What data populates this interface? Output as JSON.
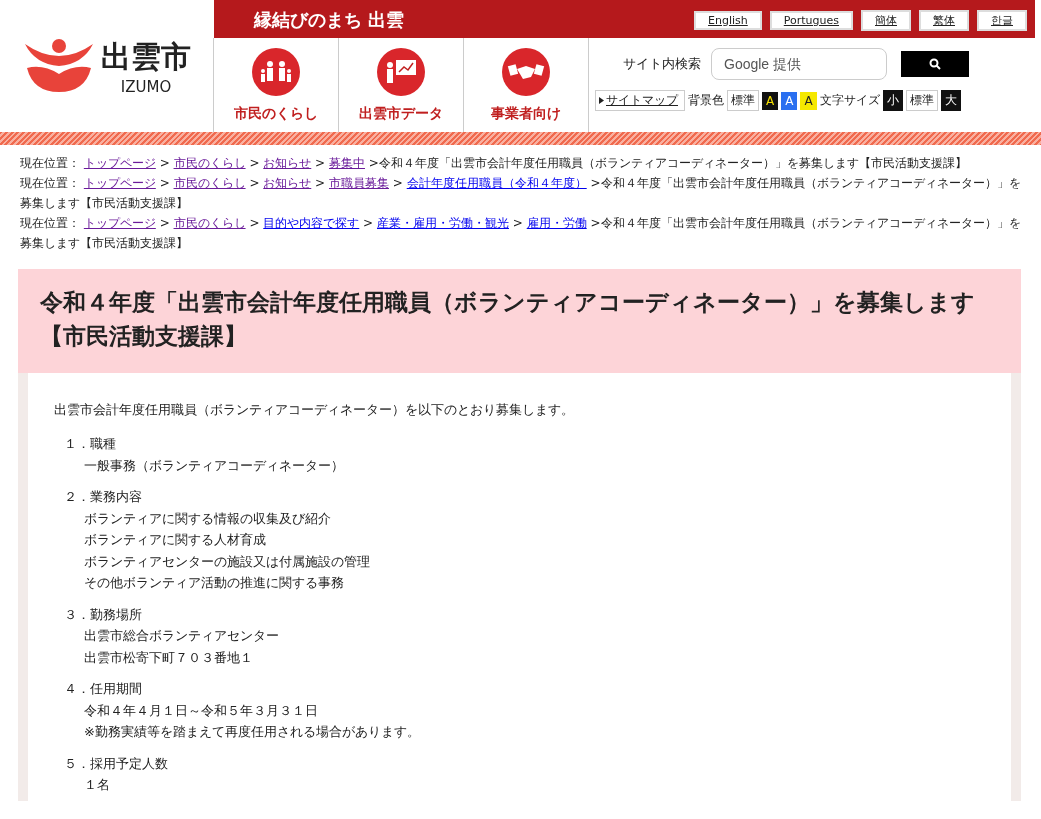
{
  "header": {
    "logo_name": "出雲市",
    "logo_roman": "IZUMO",
    "slogan": "縁結びのまち 出雲",
    "languages": [
      "English",
      "Portugues",
      "簡体",
      "繁体",
      "한글"
    ],
    "nav": [
      {
        "label": "市民のくらし",
        "kind": "family"
      },
      {
        "label": "出雲市データ",
        "kind": "chart"
      },
      {
        "label": "事業者向け",
        "kind": "handshake"
      }
    ],
    "search": {
      "label": "サイト内検索",
      "placeholder": "Google 提供"
    },
    "sitemap": "サイトマップ",
    "bg_label": "背景色",
    "bg_options": [
      {
        "label": "標準",
        "kind": "plain"
      },
      {
        "label": "A",
        "kind": "black"
      },
      {
        "label": "A",
        "kind": "blue"
      },
      {
        "label": "A",
        "kind": "yellow"
      }
    ],
    "size_label": "文字サイズ",
    "size_options": [
      {
        "label": "小",
        "kind": "dark"
      },
      {
        "label": "標準",
        "kind": "plain"
      },
      {
        "label": "大",
        "kind": "dark"
      }
    ]
  },
  "breadcrumbs": {
    "separator": ">",
    "trails": [
      {
        "label": "現在位置：",
        "links": [
          {
            "text": "トップページ",
            "visited": true
          },
          {
            "text": "市民のくらし",
            "visited": true
          },
          {
            "text": "お知らせ",
            "visited": true
          },
          {
            "text": "募集中",
            "visited": true
          }
        ],
        "current": "令和４年度「出雲市会計年度任用職員（ボランティアコーディネーター）」を募集します【市民活動支援課】"
      },
      {
        "label": "現在位置：",
        "links": [
          {
            "text": "トップページ",
            "visited": true
          },
          {
            "text": "市民のくらし",
            "visited": true
          },
          {
            "text": "お知らせ",
            "visited": true
          },
          {
            "text": "市職員募集",
            "visited": true
          },
          {
            "text": "会計年度任用職員（令和４年度）",
            "visited": false
          }
        ],
        "current": "令和４年度「出雲市会計年度任用職員（ボランティアコーディネーター）」を募集します【市民活動支援課】"
      },
      {
        "label": "現在位置：",
        "links": [
          {
            "text": "トップページ",
            "visited": true
          },
          {
            "text": "市民のくらし",
            "visited": true
          },
          {
            "text": "目的や内容で探す",
            "visited": false
          },
          {
            "text": "産業・雇用・労働・観光",
            "visited": false
          },
          {
            "text": "雇用・労働",
            "visited": false
          }
        ],
        "current": "令和４年度「出雲市会計年度任用職員（ボランティアコーディネーター）」を募集します【市民活動支援課】"
      }
    ]
  },
  "title": "令和４年度「出雲市会計年度任用職員（ボランティアコーディネーター）」を募集します【市民活動支援課】",
  "intro": "出雲市会計年度任用職員（ボランティアコーディネーター）を以下のとおり募集します。",
  "sections": [
    {
      "number": "１．",
      "heading": "職種",
      "lines": [
        "一般事務（ボランティアコーディネーター）"
      ]
    },
    {
      "number": "２．",
      "heading": "業務内容",
      "lines": [
        "ボランティアに関する情報の収集及び紹介",
        "ボランティアに関する人材育成",
        "ボランティアセンターの施設又は付属施設の管理",
        "その他ボランティア活動の推進に関する事務"
      ]
    },
    {
      "number": "３．",
      "heading": "勤務場所",
      "lines": [
        "出雲市総合ボランティアセンター",
        "出雲市松寄下町７０３番地１"
      ]
    },
    {
      "number": "４．",
      "heading": "任用期間",
      "lines": [
        "令和４年４月１日～令和５年３月３１日",
        "※勤務実績等を踏まえて再度任用される場合があります。"
      ]
    },
    {
      "number": "５．",
      "heading": "採用予定人数",
      "lines": [
        "１名"
      ]
    }
  ]
}
